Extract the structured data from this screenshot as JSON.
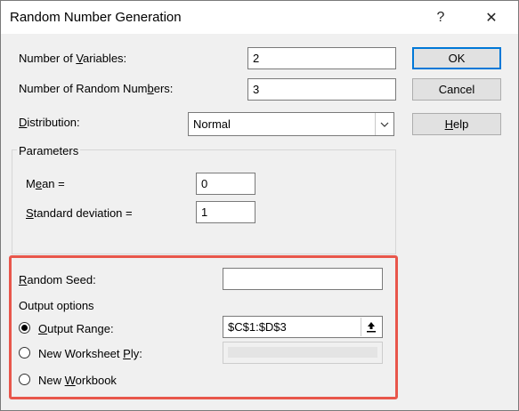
{
  "window": {
    "title": "Random Number Generation",
    "help_glyph": "?",
    "close_glyph": "✕"
  },
  "fields": {
    "num_variables_label": "Number of Variables:",
    "num_variables_value": "2",
    "num_random_label": "Number of Random Numbers:",
    "num_random_value": "3",
    "distribution_label": "Distribution:",
    "distribution_value": "Normal"
  },
  "buttons": {
    "ok": "OK",
    "cancel": "Cancel",
    "help": "Help"
  },
  "parameters": {
    "title": "Parameters",
    "mean_label": "Mean =",
    "mean_value": "0",
    "std_label": "Standard deviation =",
    "std_value": "1"
  },
  "seed": {
    "label": "Random Seed:",
    "value": ""
  },
  "output": {
    "title": "Output options",
    "range_label": "Output Range:",
    "range_value": "$C$1:$D$3",
    "worksheet_label": "New Worksheet Ply:",
    "workbook_label": "New Workbook",
    "selected": "Output Range"
  },
  "colors": {
    "highlight": "#e8564b",
    "default_button_border": "#0078d7"
  }
}
